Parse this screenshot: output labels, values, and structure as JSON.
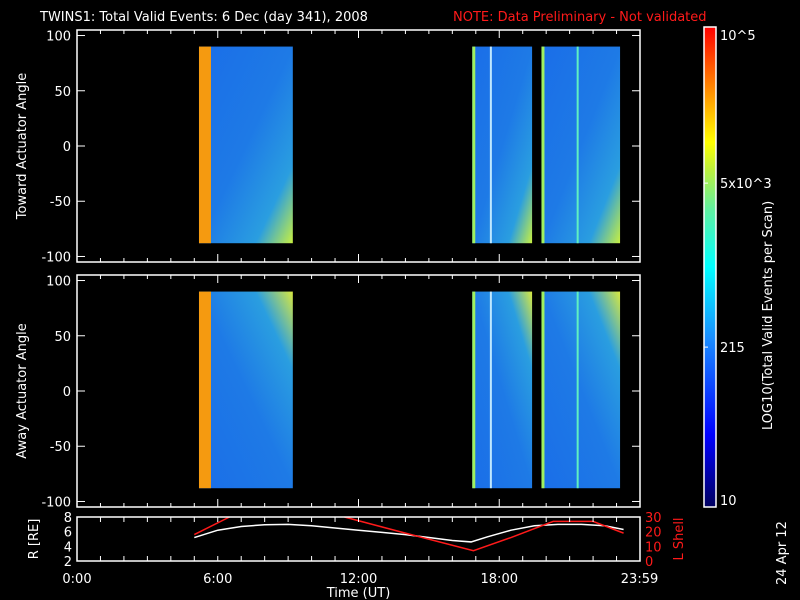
{
  "title": "TWINS1: Total Valid Events:  6 Dec (day 341), 2008",
  "note": "NOTE: Data Preliminary - Not validated",
  "side_date": "24 Apr 12",
  "colors": {
    "note": "#ff1a1a",
    "axis": "#ffffff",
    "lshell": "#ff1a1a",
    "radius": "#ffffff"
  },
  "chart_data": [
    {
      "type": "heatmap",
      "ylabel": "Toward Actuator Angle",
      "ylim": [
        -105,
        105
      ],
      "yticks": [
        "100",
        "50",
        "0",
        "-50",
        "-100"
      ],
      "ytick_values": [
        100,
        50,
        0,
        -50,
        -100
      ],
      "xlim_hours": [
        0,
        24
      ],
      "data_intervals_hours": [
        [
          5.2,
          9.2
        ],
        [
          16.85,
          19.4
        ],
        [
          19.8,
          23.15
        ]
      ],
      "angle_range": [
        -88,
        90
      ]
    },
    {
      "type": "heatmap",
      "ylabel": "Away Actuator Angle",
      "ylim": [
        -105,
        105
      ],
      "yticks": [
        "100",
        "50",
        "0",
        "-50",
        "-100"
      ],
      "ytick_values": [
        100,
        50,
        0,
        -50,
        -100
      ],
      "xlim_hours": [
        0,
        24
      ],
      "data_intervals_hours": [
        [
          5.2,
          9.2
        ],
        [
          16.85,
          19.4
        ],
        [
          19.8,
          23.15
        ]
      ],
      "angle_range": [
        -88,
        90
      ]
    },
    {
      "type": "line",
      "xlabel": "Time (UT)",
      "xticks": [
        "0:00",
        "6:00",
        "12:00",
        "18:00",
        "23:59"
      ],
      "xtick_values": [
        0,
        6,
        12,
        18,
        23.98
      ],
      "ylabel": "R [RE]",
      "ylim": [
        2,
        8
      ],
      "yticks": [
        "8",
        "6",
        "4",
        "2"
      ],
      "y2label": "L Shell",
      "y2lim": [
        0,
        30
      ],
      "y2ticks": [
        "30",
        "20",
        "10",
        "0"
      ],
      "series": [
        {
          "name": "R",
          "x": [
            5.0,
            6.0,
            7.0,
            8.0,
            9.0,
            10.0,
            11.0,
            12.0,
            13.0,
            14.0,
            15.0,
            16.0,
            16.8,
            17.5,
            18.5,
            19.5,
            20.5,
            21.5,
            22.5,
            23.3
          ],
          "y": [
            5.2,
            6.2,
            6.7,
            6.95,
            7.0,
            6.8,
            6.5,
            6.2,
            5.9,
            5.6,
            5.2,
            4.8,
            4.6,
            5.3,
            6.2,
            6.8,
            7.0,
            7.0,
            6.8,
            6.3
          ]
        },
        {
          "name": "L Shell",
          "x": [
            5.0,
            6.5
          ],
          "y": [
            18,
            30
          ]
        },
        {
          "name": "L Shell",
          "x": [
            11.4,
            14.0,
            16.9,
            18.5,
            20.3,
            22.0,
            23.3
          ],
          "y": [
            30,
            19,
            7,
            16,
            27,
            27,
            19
          ]
        }
      ]
    }
  ],
  "colorbar": {
    "label": "LOG10(Total Valid Events per Scan)",
    "ticks": [
      "10^5",
      "5x10^3",
      "215",
      "10"
    ],
    "tick_values": [
      100000,
      5000,
      215,
      10
    ]
  }
}
